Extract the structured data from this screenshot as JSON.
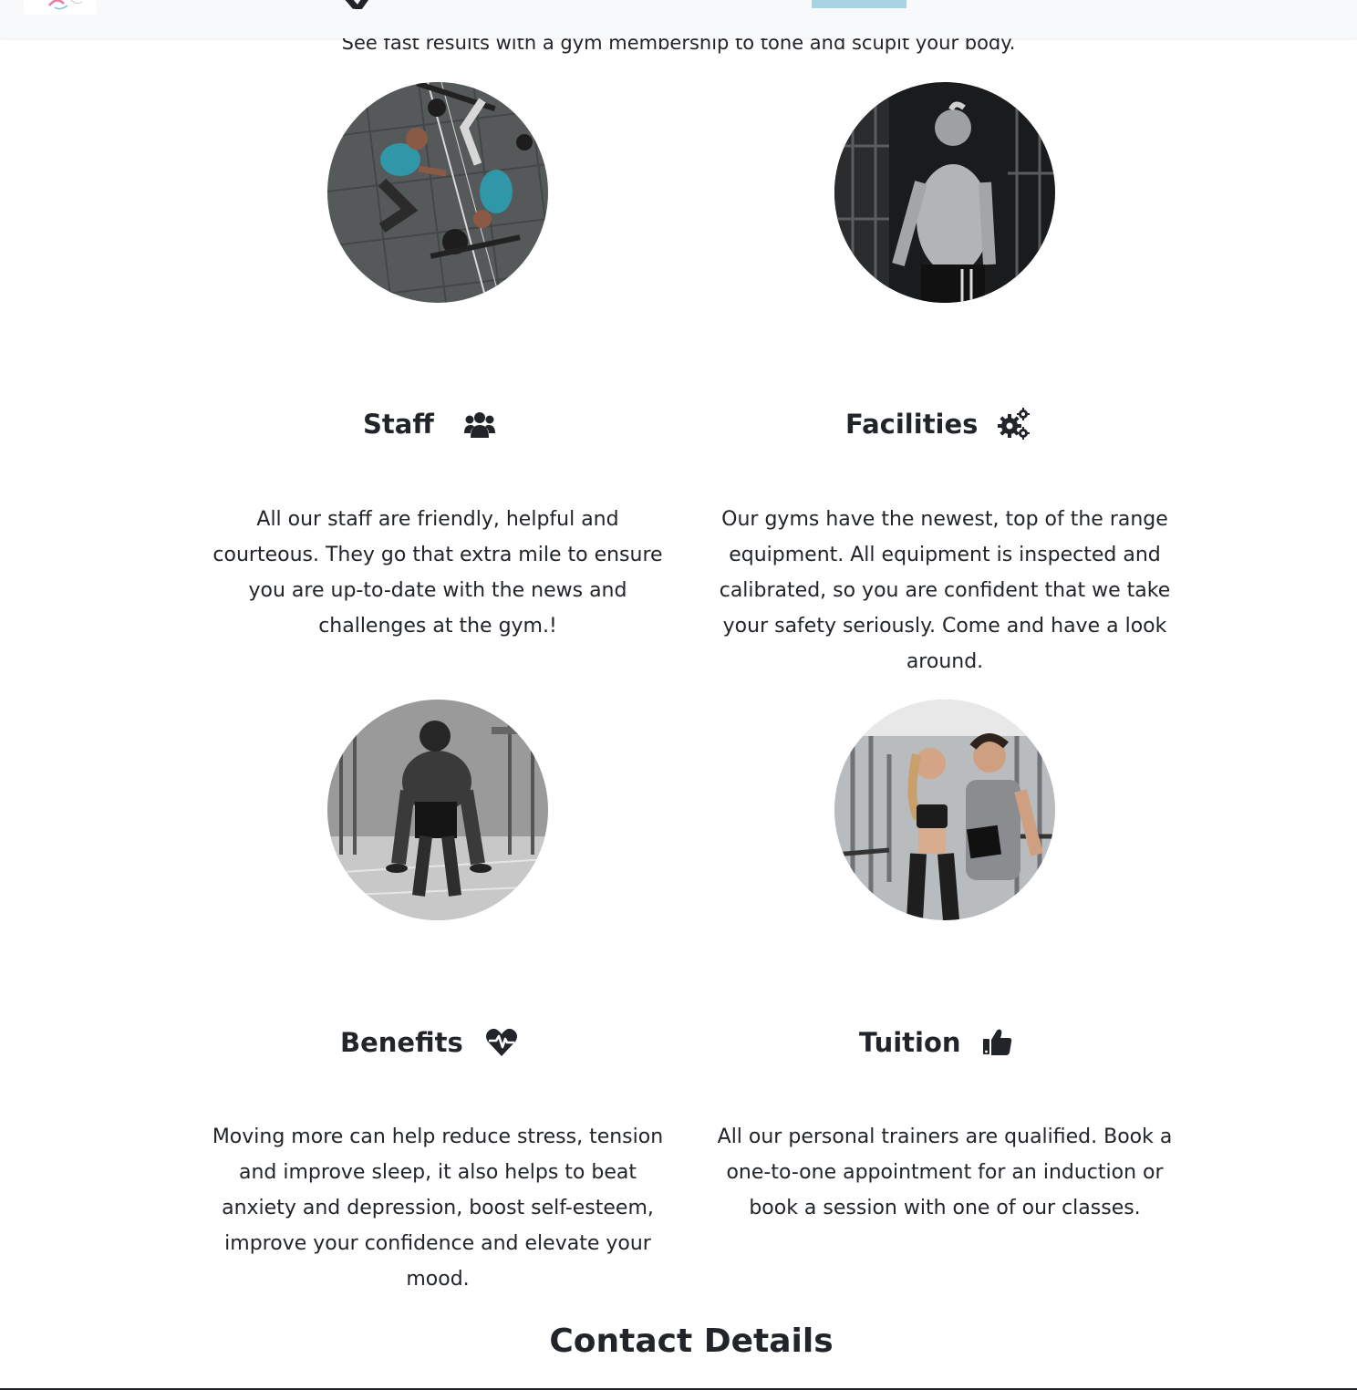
{
  "header": {
    "logo_icon": "brand-logo-icon",
    "active_nav_color": "#a8d3e2"
  },
  "intro": {
    "tagline": "See fast results with a gym membership to tone and scupit your body."
  },
  "features": [
    {
      "title": "Staff",
      "icon": "users-icon",
      "text": "All our staff are friendly, helpful and courteous. They go that extra mile to ensure you are up-to-date with the news and challenges at the gym.!"
    },
    {
      "title": "Facilities",
      "icon": "cogs-icon",
      "text": "Our gyms have the newest, top of the range equipment. All equipment is inspected and calibrated, so you are confident that we take your safety seriously. Come and have a look around."
    },
    {
      "title": "Benefits",
      "icon": "heartbeat-icon",
      "text": "Moving more can help reduce stress, tension and improve sleep, it also helps to beat anxiety and depression, boost self-esteem, improve your confidence and elevate your mood."
    },
    {
      "title": "Tuition",
      "icon": "thumbs-up-icon",
      "text": "All our personal trainers are qualified. Book a one-to-one appointment for an induction or book a session with one of our classes."
    }
  ],
  "contact": {
    "heading": "Contact Details"
  }
}
